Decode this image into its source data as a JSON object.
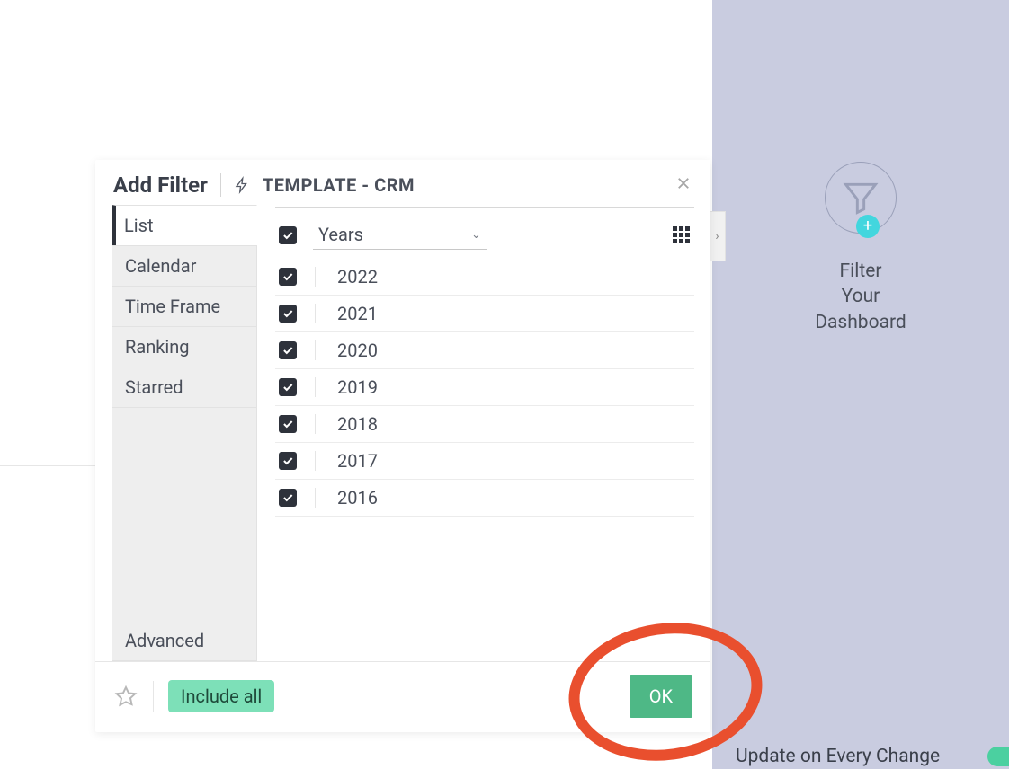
{
  "dialog": {
    "title": "Add Filter",
    "template_label": "TEMPLATE - CRM",
    "tabs": {
      "list": "List",
      "calendar": "Calendar",
      "timeframe": "Time Frame",
      "ranking": "Ranking",
      "starred": "Starred",
      "advanced": "Advanced"
    },
    "dropdown": {
      "label": "Years"
    },
    "years": [
      "2022",
      "2021",
      "2020",
      "2019",
      "2018",
      "2017",
      "2016"
    ],
    "footer": {
      "include_label": "Include all",
      "ok_label": "OK"
    }
  },
  "right_panel": {
    "promo_line1": "Filter",
    "promo_line2": "Your",
    "promo_line3": "Dashboard",
    "update_label": "Update on Every Change"
  },
  "icons": {
    "plus": "+",
    "chevron_right": "›"
  }
}
